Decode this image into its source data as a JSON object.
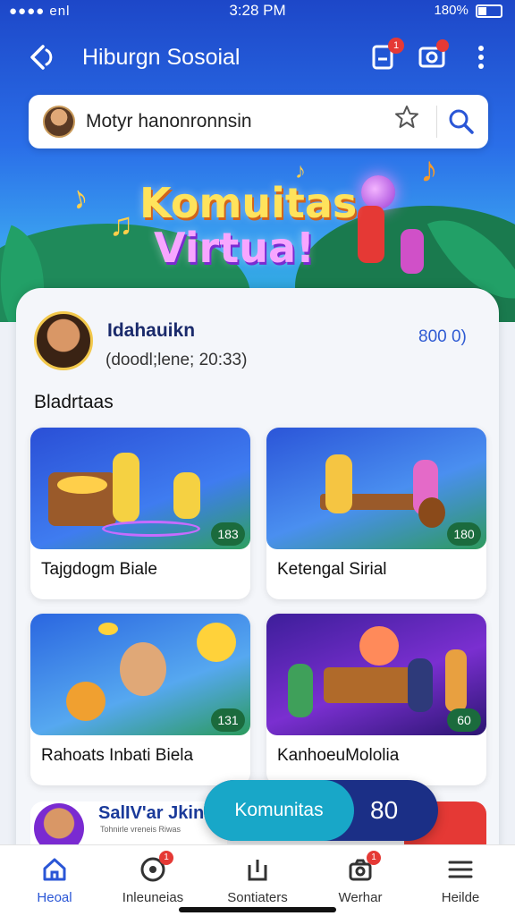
{
  "status": {
    "time": "3:28 PM",
    "carrier": "●●●● enl",
    "battery": "180%"
  },
  "header": {
    "title": "Hiburgn Sosoial",
    "notif_badge": "1"
  },
  "search": {
    "value": "Motyr hanonronnsin"
  },
  "banner": {
    "line1": "Komuitas",
    "line2": "Virtua!"
  },
  "profile": {
    "name": "Idahauikn",
    "meta": "(doodl;lene; 20:33)",
    "count": "800 0)"
  },
  "section_title": "Bladrtaas",
  "cards": [
    {
      "title": "Tajgdogm Biale",
      "count": "183"
    },
    {
      "title": "Ketengal Sirial",
      "count": "180"
    },
    {
      "title": "Rahoats Inbati Biela",
      "count": "131"
    },
    {
      "title": "KanhoeuMololia",
      "count": "60"
    }
  ],
  "peek_card": {
    "title": "SalIV'ar Jkin",
    "subtitle": "Tohnirle vreneis Riwas"
  },
  "community_pill": {
    "label": "Komunitas",
    "count": "80"
  },
  "tabs": [
    {
      "label": "Heoal",
      "icon": "home-icon"
    },
    {
      "label": "Inleuneias",
      "icon": "record-icon",
      "badge": "1"
    },
    {
      "label": "Sontiaters",
      "icon": "upload-icon"
    },
    {
      "label": "Werhar",
      "icon": "camera-bag-icon",
      "badge": "1"
    },
    {
      "label": "Heilde",
      "icon": "menu-icon"
    }
  ],
  "colors": {
    "accent": "#2a56d6",
    "badge": "#e53935",
    "pill": "#18a7c8",
    "pill_bg": "#1b2f86"
  }
}
